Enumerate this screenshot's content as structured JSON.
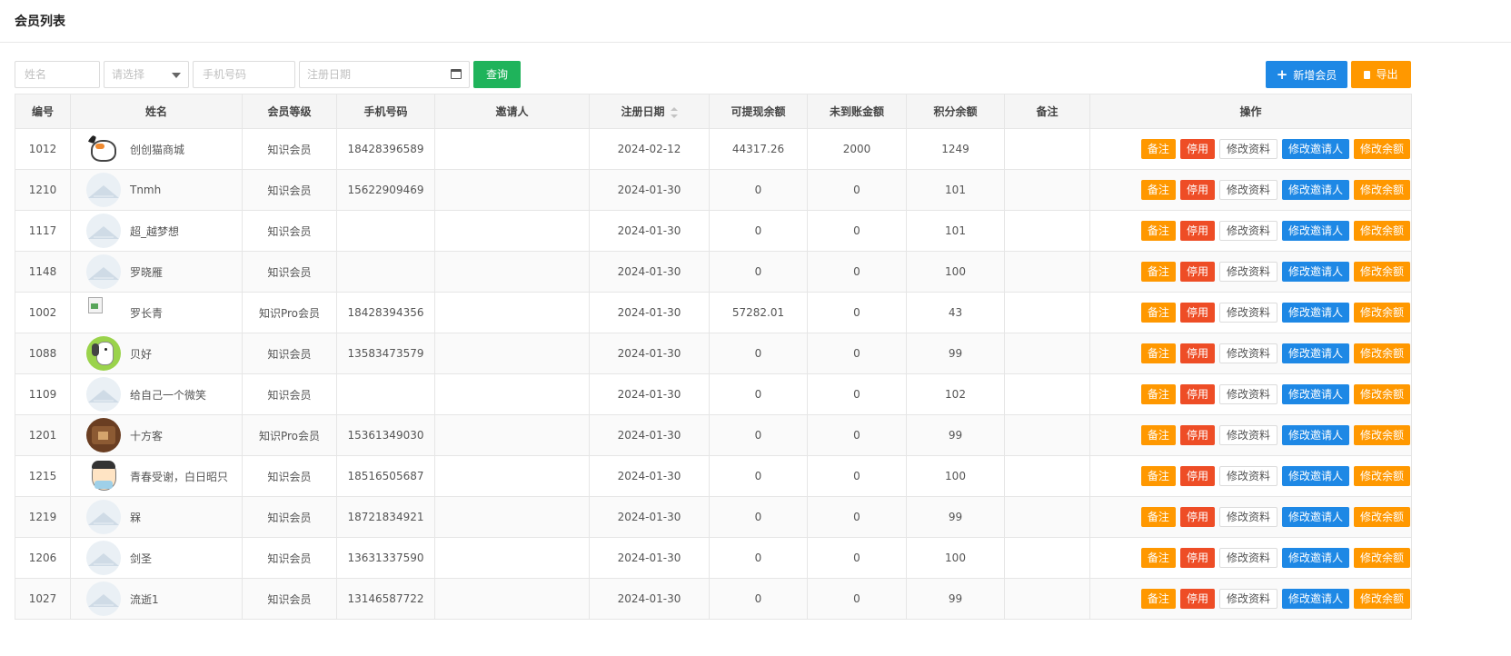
{
  "page": {
    "title": "会员列表"
  },
  "filters": {
    "name_placeholder": "姓名",
    "level_placeholder": "请选择",
    "phone_placeholder": "手机号码",
    "date_placeholder": "注册日期",
    "query_label": "查询",
    "add_label": "新增会员",
    "export_label": "导出"
  },
  "table": {
    "headers": [
      "编号",
      "姓名",
      "会员等级",
      "手机号码",
      "邀请人",
      "注册日期",
      "可提现余额",
      "未到账金额",
      "积分余额",
      "备注",
      "操作"
    ],
    "actions": [
      "备注",
      "停用",
      "修改资料",
      "修改邀请人",
      "修改余额"
    ],
    "rows": [
      {
        "id": "1012",
        "name": "创创猫商城",
        "avatar": "cat",
        "level": "知识会员",
        "phone": "18428396589",
        "inviter": "",
        "date": "2024-02-12",
        "withdrawable": "44317.26",
        "pending": "2000",
        "points": "1249",
        "note": ""
      },
      {
        "id": "1210",
        "name": "Tnmh",
        "avatar": "placeholder",
        "level": "知识会员",
        "phone": "15622909469",
        "inviter": "",
        "date": "2024-01-30",
        "withdrawable": "0",
        "pending": "0",
        "points": "101",
        "note": ""
      },
      {
        "id": "1117",
        "name": "超_越梦想",
        "avatar": "placeholder",
        "level": "知识会员",
        "phone": "",
        "inviter": "",
        "date": "2024-01-30",
        "withdrawable": "0",
        "pending": "0",
        "points": "101",
        "note": ""
      },
      {
        "id": "1148",
        "name": "罗晓雁",
        "avatar": "placeholder",
        "level": "知识会员",
        "phone": "",
        "inviter": "",
        "date": "2024-01-30",
        "withdrawable": "0",
        "pending": "0",
        "points": "100",
        "note": ""
      },
      {
        "id": "1002",
        "name": "罗长青",
        "avatar": "broken",
        "level": "知识Pro会员",
        "phone": "18428394356",
        "inviter": "",
        "date": "2024-01-30",
        "withdrawable": "57282.01",
        "pending": "0",
        "points": "43",
        "note": ""
      },
      {
        "id": "1088",
        "name": "贝好",
        "avatar": "dog",
        "level": "知识会员",
        "phone": "13583473579",
        "inviter": "",
        "date": "2024-01-30",
        "withdrawable": "0",
        "pending": "0",
        "points": "99",
        "note": ""
      },
      {
        "id": "1109",
        "name": "给自己一个微笑",
        "avatar": "placeholder",
        "level": "知识会员",
        "phone": "",
        "inviter": "",
        "date": "2024-01-30",
        "withdrawable": "0",
        "pending": "0",
        "points": "102",
        "note": ""
      },
      {
        "id": "1201",
        "name": "十方客",
        "avatar": "brown",
        "level": "知识Pro会员",
        "phone": "15361349030",
        "inviter": "",
        "date": "2024-01-30",
        "withdrawable": "0",
        "pending": "0",
        "points": "99",
        "note": ""
      },
      {
        "id": "1215",
        "name": "青春受谢，白日昭只",
        "avatar": "face",
        "level": "知识会员",
        "phone": "18516505687",
        "inviter": "",
        "date": "2024-01-30",
        "withdrawable": "0",
        "pending": "0",
        "points": "100",
        "note": ""
      },
      {
        "id": "1219",
        "name": "槑",
        "avatar": "placeholder",
        "level": "知识会员",
        "phone": "18721834921",
        "inviter": "",
        "date": "2024-01-30",
        "withdrawable": "0",
        "pending": "0",
        "points": "99",
        "note": ""
      },
      {
        "id": "1206",
        "name": "剑圣",
        "avatar": "placeholder",
        "level": "知识会员",
        "phone": "13631337590",
        "inviter": "",
        "date": "2024-01-30",
        "withdrawable": "0",
        "pending": "0",
        "points": "100",
        "note": ""
      },
      {
        "id": "1027",
        "name": "流逝1",
        "avatar": "placeholder",
        "level": "知识会员",
        "phone": "13146587722",
        "inviter": "",
        "date": "2024-01-30",
        "withdrawable": "0",
        "pending": "0",
        "points": "99",
        "note": ""
      }
    ]
  }
}
